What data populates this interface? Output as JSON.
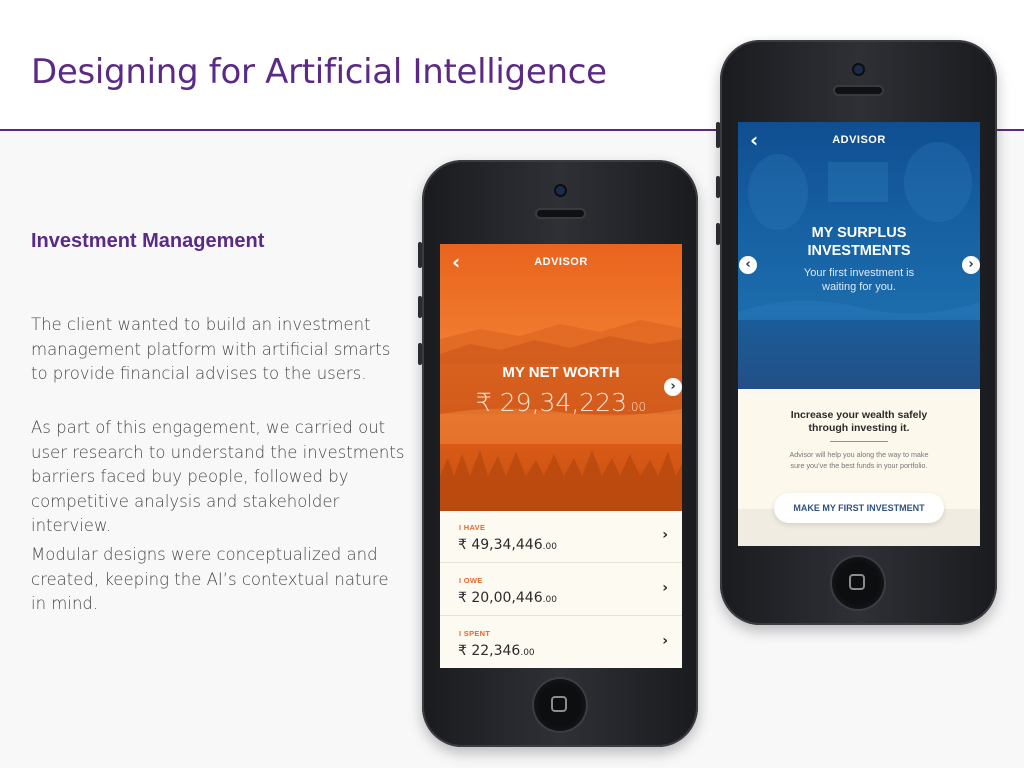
{
  "slide": {
    "title": "Designing for Artificial Intelligence",
    "subtitle": "Investment Management",
    "paragraphs": [
      "The client wanted to build an investment management platform with artificial smarts to provide financial advises to the users.",
      "As part of this engagement, we carried out user research to understand the investments barriers faced buy people, followed by competitive analysis and stakeholder interview.",
      "Modular designs were conceptualized and created, keeping the AI’s contextual nature in mind."
    ],
    "accent_color": "#5b2a86"
  },
  "phone1": {
    "nav_title": "ADVISOR",
    "back_icon": "chevron-left-icon",
    "net_worth_label": "MY NET WORTH",
    "net_worth_value": "₹ 29,34,223",
    "net_worth_decimals": ".00",
    "rows": [
      {
        "label": "I HAVE",
        "value": "₹ 49,34,446",
        "decimals": ".00"
      },
      {
        "label": "I OWE",
        "value": "₹ 20,00,446",
        "decimals": ".00"
      },
      {
        "label": "I SPENT",
        "value": "₹ 22,346",
        "decimals": ".00"
      }
    ],
    "hero_color": "#e9641e"
  },
  "phone2": {
    "nav_title": "ADVISOR",
    "card_title_line1": "MY SURPLUS",
    "card_title_line2": "INVESTMENTS",
    "card_sub_line1": "Your first investment is",
    "card_sub_line2": "waiting for you.",
    "headline_line1": "Increase your wealth safely",
    "headline_line2": "through investing it.",
    "body_line1": "Advisor will help you along the way to make",
    "body_line2": "sure you’ve the best funds in your portfolio.",
    "cta": "MAKE MY FIRST INVESTMENT",
    "hero_color": "#1866a8"
  }
}
